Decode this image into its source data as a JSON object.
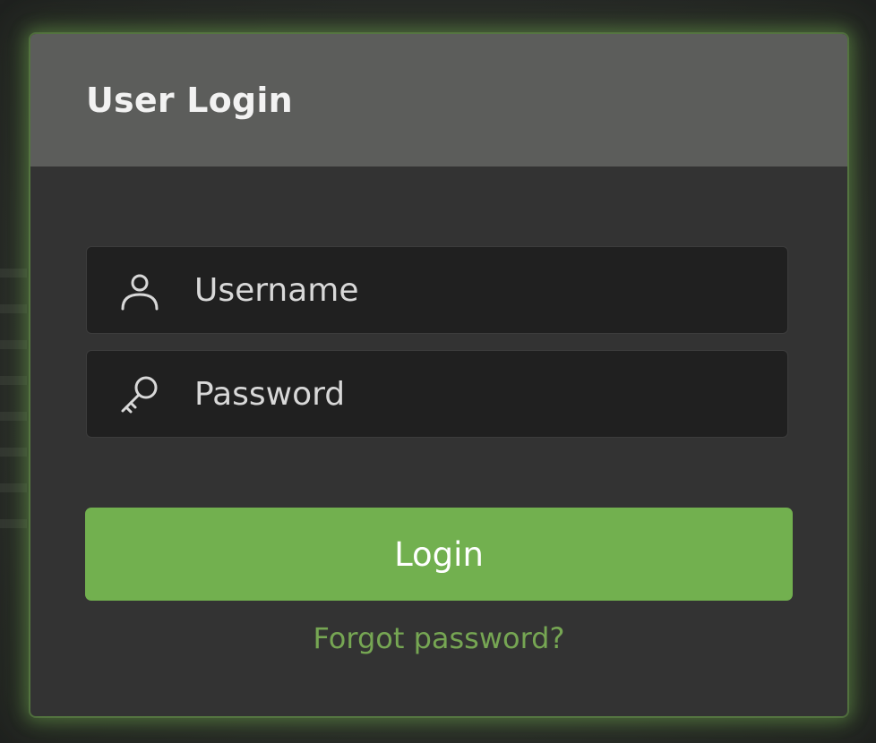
{
  "dialog": {
    "title": "User Login"
  },
  "form": {
    "username": {
      "placeholder": "Username",
      "value": "",
      "icon": "user-icon"
    },
    "password": {
      "placeholder": "Password",
      "value": "",
      "icon": "key-icon"
    },
    "login_label": "Login",
    "forgot_label": "Forgot password?"
  },
  "colors": {
    "accent": "#72b04f",
    "link": "#76a653",
    "header": "#5c5d5b",
    "panel": "#333333",
    "field": "#202020"
  }
}
